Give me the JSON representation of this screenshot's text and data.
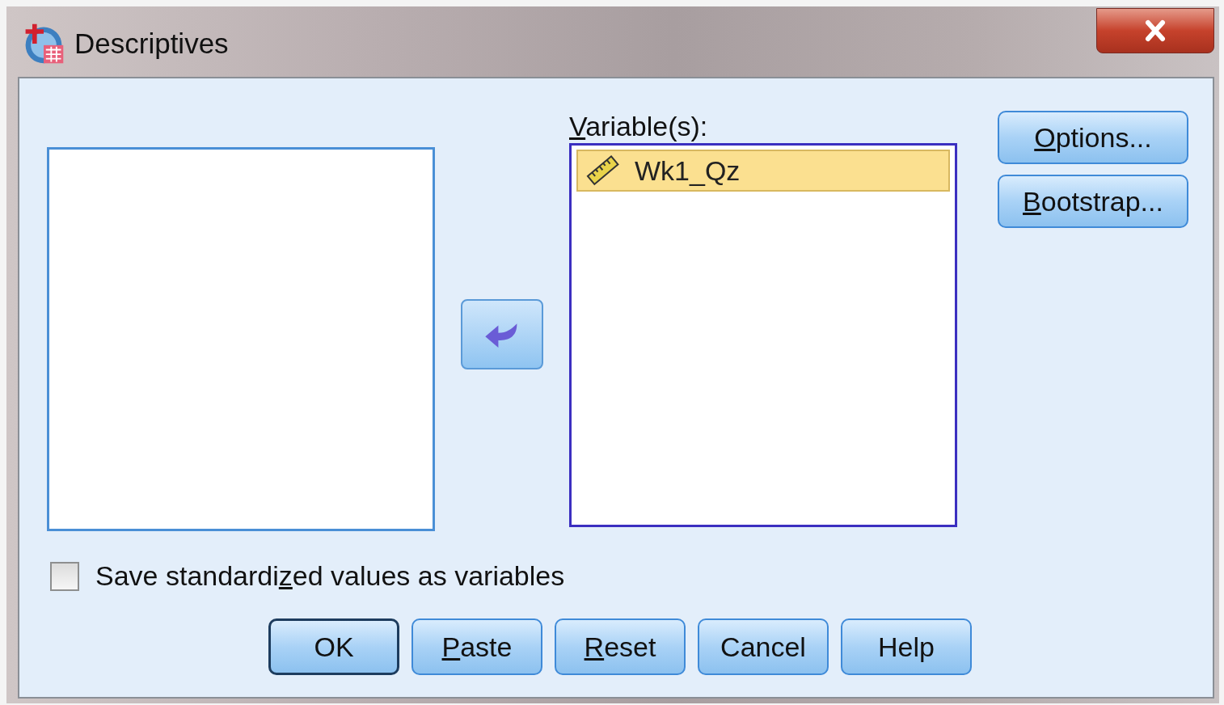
{
  "window": {
    "title": "Descriptives"
  },
  "target": {
    "label": {
      "key": "V",
      "after": "ariable(s):"
    },
    "items": [
      {
        "name": "Wk1_Qz",
        "selected": true
      }
    ]
  },
  "side_buttons": [
    {
      "key": "O",
      "after": "ptions..."
    },
    {
      "key": "B",
      "after": "ootstrap..."
    }
  ],
  "save_option": {
    "before": "Save standardi",
    "key": "z",
    "after": "ed values as variables",
    "checked": false
  },
  "buttons": [
    {
      "before": "OK",
      "default": true
    },
    {
      "key": "P",
      "after": "aste",
      "default": false
    },
    {
      "key": "R",
      "after": "eset",
      "default": false
    },
    {
      "before": "Cancel",
      "default": false
    },
    {
      "before": "Help",
      "default": false
    }
  ]
}
